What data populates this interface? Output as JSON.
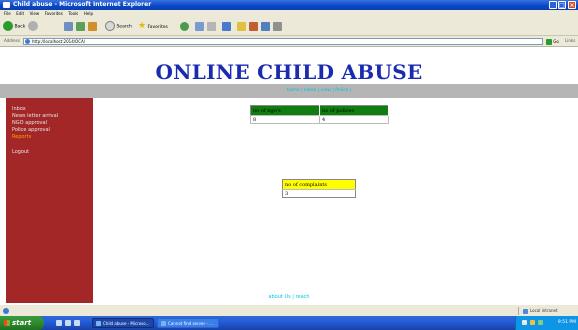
{
  "window": {
    "title": "Child abuse - Microsoft Internet Explorer"
  },
  "menu": [
    "File",
    "Edit",
    "View",
    "Favorites",
    "Tools",
    "Help"
  ],
  "toolbar": {
    "back_label": "Back",
    "search_label": "Search",
    "favorites_label": "Favorites"
  },
  "address": {
    "label": "Address",
    "url": "http://localhost:2014/OCA/",
    "go_label": "Go",
    "links_label": "Links"
  },
  "page": {
    "site_title": "ONLINE CHILD ABUSE",
    "nav_links": "home | Inbox | view | Police |",
    "sidebar": [
      {
        "label": "Inbox",
        "active": false
      },
      {
        "label": "News letter arrival",
        "active": false
      },
      {
        "label": "NGO approval",
        "active": false
      },
      {
        "label": "Police approval",
        "active": false
      },
      {
        "label": "Reports",
        "active": true
      },
      {
        "label": "Logout",
        "active": false
      }
    ],
    "stats_table": {
      "headers": [
        "no of ngo's",
        "no of polices"
      ],
      "values": [
        "8",
        "4"
      ]
    },
    "complaints_table": {
      "header": "no of complaints",
      "value": "3"
    },
    "footer_links": "about Us | reach"
  },
  "statusbar": {
    "zone": "Local intranet"
  },
  "taskbar": {
    "start_label": "start",
    "tasks": [
      "Child abuse - Microso...",
      "Cannot find server - ..."
    ],
    "clock": "9:51 PM"
  }
}
